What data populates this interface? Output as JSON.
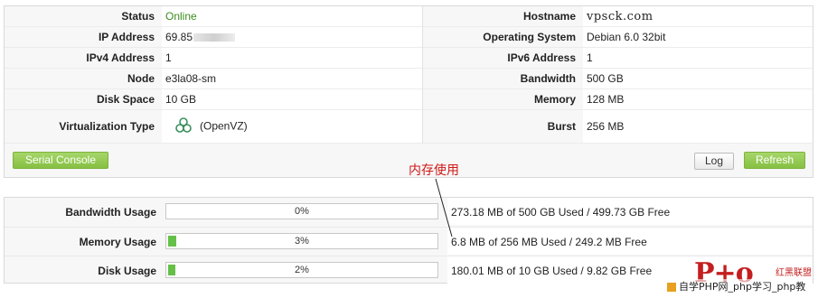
{
  "info": {
    "status_label": "Status",
    "status_value": "Online",
    "hostname_label": "Hostname",
    "hostname_value": "vpsck.com",
    "ip_label": "IP Address",
    "ip_value": "69.85",
    "os_label": "Operating System",
    "os_value": "Debian 6.0 32bit",
    "ipv4_label": "IPv4 Address",
    "ipv4_value": "1",
    "ipv6_label": "IPv6 Address",
    "ipv6_value": "1",
    "node_label": "Node",
    "node_value": "e3la08-sm",
    "bandwidth_label": "Bandwidth",
    "bandwidth_value": "500 GB",
    "disk_label": "Disk Space",
    "disk_value": "10 GB",
    "memory_label": "Memory",
    "memory_value": "128 MB",
    "virt_label": "Virtualization Type",
    "virt_value": "(OpenVZ)",
    "virt_icon": "openvz-logo-icon",
    "burst_label": "Burst",
    "burst_value": "256 MB"
  },
  "buttons": {
    "serial_console": "Serial Console",
    "log": "Log",
    "refresh": "Refresh"
  },
  "usage": [
    {
      "label": "Bandwidth Usage",
      "percent_text": "0%",
      "fraction": 0.0,
      "detail": "273.18 MB of 500 GB Used / 499.73 GB Free"
    },
    {
      "label": "Memory Usage",
      "percent_text": "3%",
      "fraction": 0.03,
      "detail": "6.8 MB of 256 MB Used / 249.2 MB Free"
    },
    {
      "label": "Disk Usage",
      "percent_text": "2%",
      "fraction": 0.02,
      "detail": "180.01 MB of 10 GB Used / 9.82 GB Free"
    }
  ],
  "annotation": {
    "text": "内存使用",
    "color": "#d01818"
  },
  "watermark": {
    "logo": "P+o",
    "org": "红黑联盟",
    "subtitle": "自学PHP网_php学习_php教"
  },
  "colors": {
    "online": "#3c8a1e",
    "accent_green": "#86c043",
    "progress_fill": "#65c047"
  }
}
